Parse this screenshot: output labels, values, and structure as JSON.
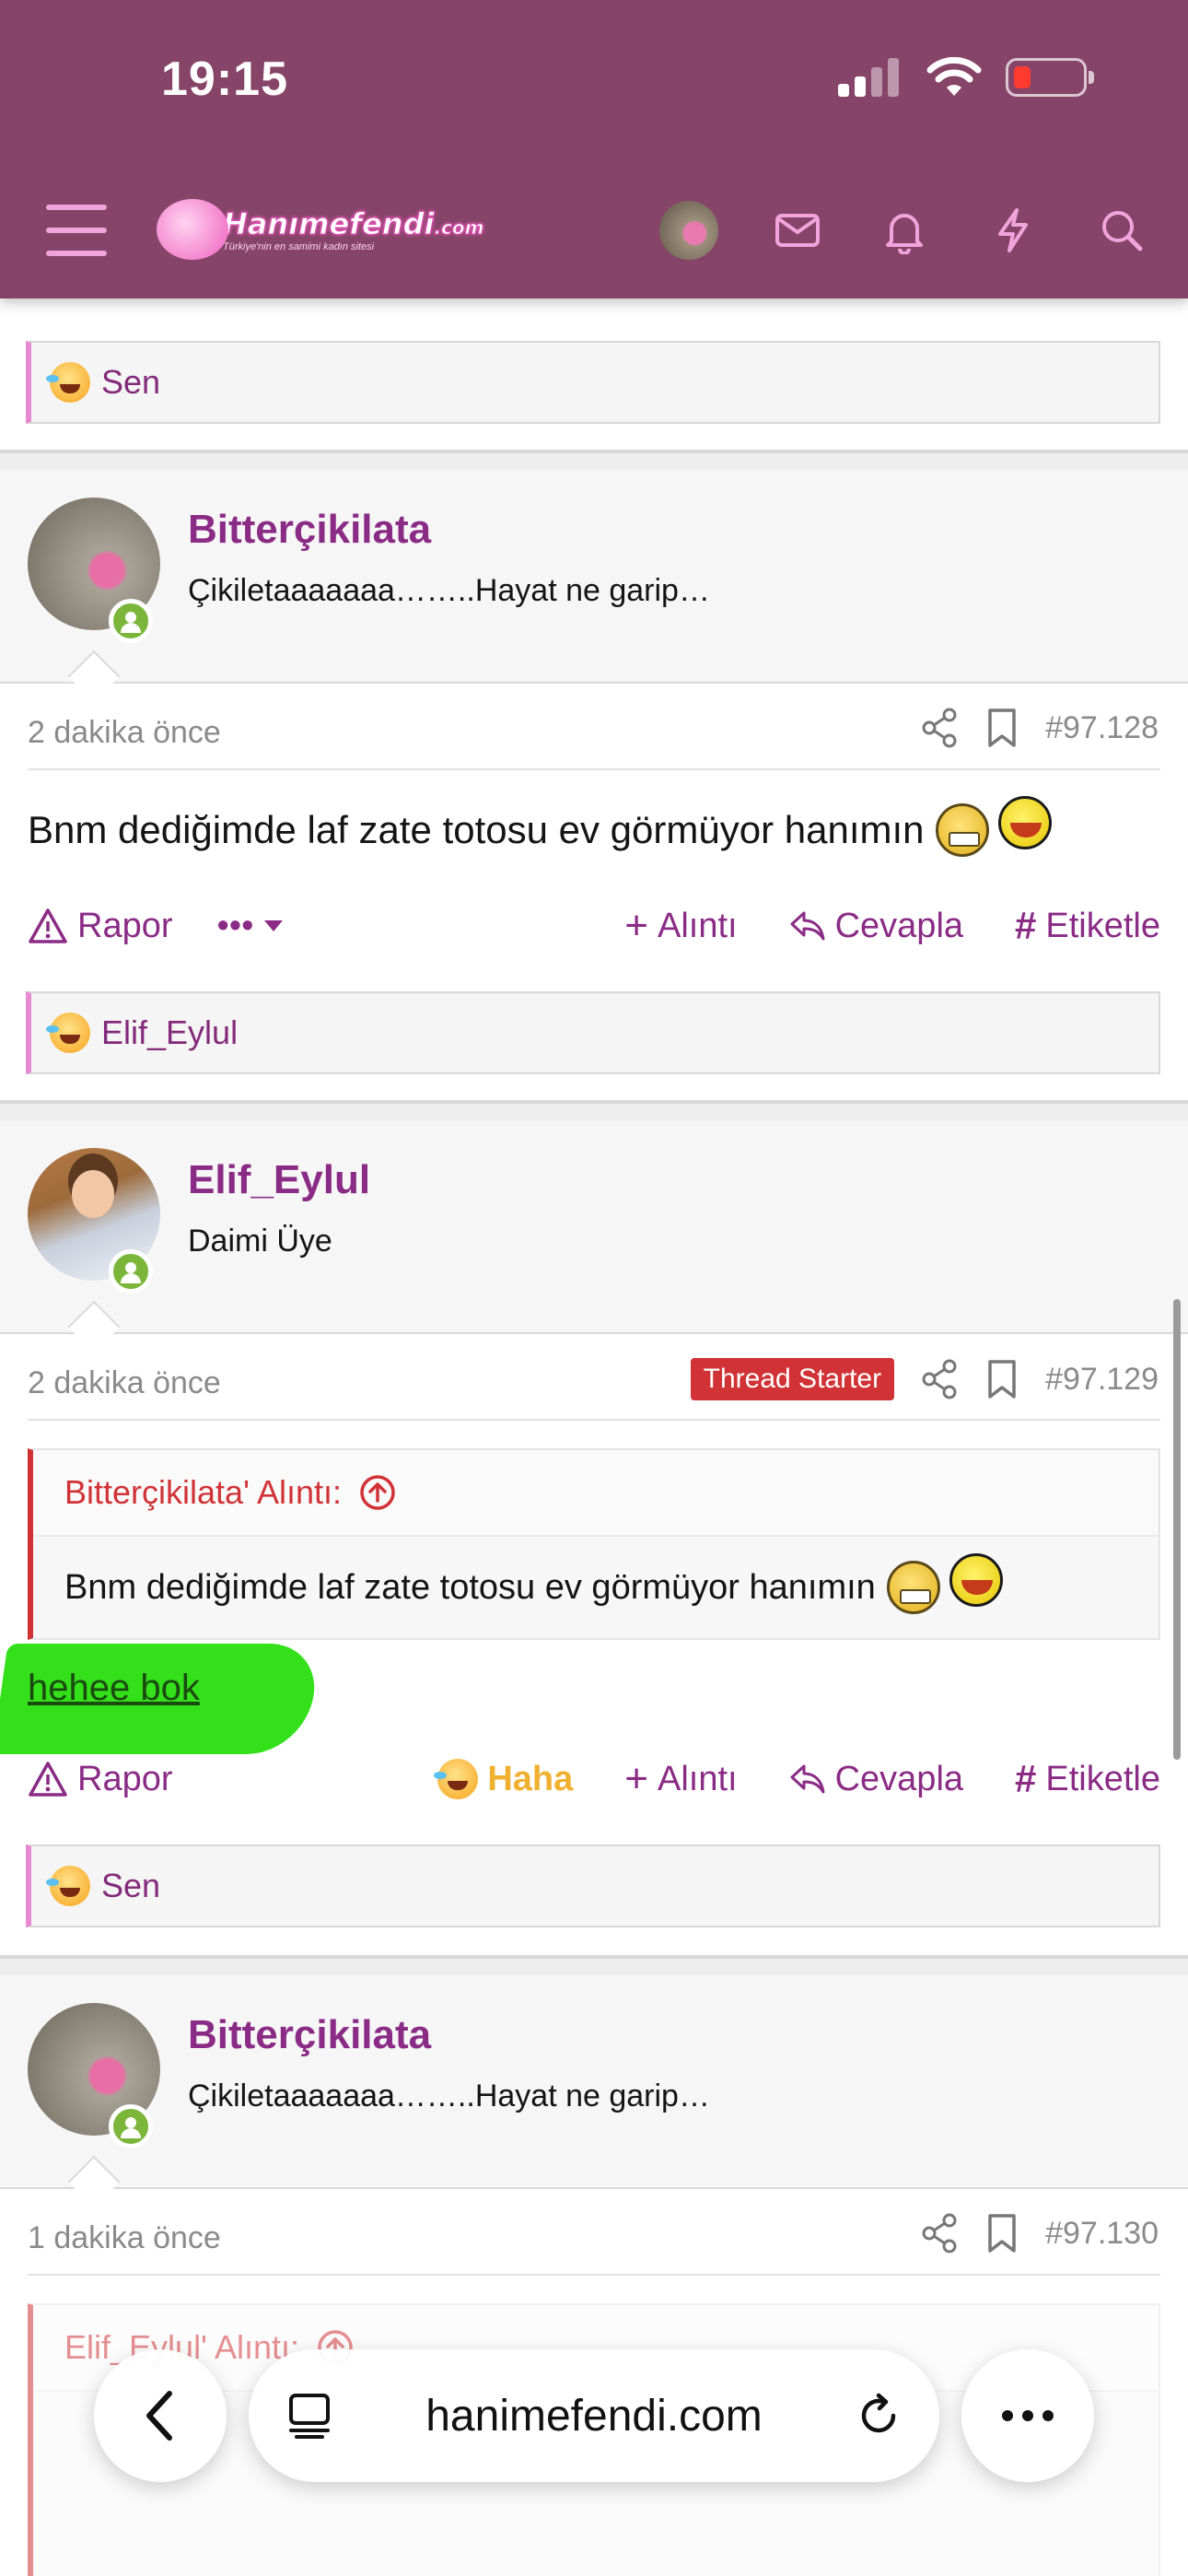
{
  "status_bar": {
    "time": "19:15"
  },
  "header": {
    "logo_name": "Hanımefendi",
    "logo_suffix": ".com",
    "logo_tagline": "Türkiye'nin en samimi kadın sitesi",
    "icons": [
      "menu-icon",
      "avatar",
      "mail-icon",
      "bell-icon",
      "bolt-icon",
      "search-icon"
    ]
  },
  "top_reaction": {
    "label": "Sen"
  },
  "posts": [
    {
      "username": "Bitterçikilata",
      "user_title": "Çikiletaaaaaaa……..Hayat ne garip…",
      "time": "2 dakika önce",
      "number": "#97.128",
      "message": "Bnm dediğimde laf zate totosu ev görmüyor hanımın",
      "actions": {
        "report": "Rapor",
        "more": "•••",
        "quote": "Alıntı",
        "reply": "Cevapla",
        "tag": "Etiketle"
      },
      "reaction": "Elif_Eylul"
    },
    {
      "username": "Elif_Eylul",
      "user_title": "Daimi Üye",
      "time": "2 dakika önce",
      "badge": "Thread Starter",
      "number": "#97.129",
      "quote_author": "Bitterçikilata' Alıntı:",
      "quote_text": "Bnm dediğimde laf zate totosu ev görmüyor hanımın",
      "message": "hehee bok",
      "actions": {
        "report": "Rapor",
        "haha": "Haha",
        "quote": "Alıntı",
        "reply": "Cevapla",
        "tag": "Etiketle"
      },
      "reaction": "Sen"
    },
    {
      "username": "Bitterçikilata",
      "user_title": "Çikiletaaaaaaa……..Hayat ne garip…",
      "time": "1 dakika önce",
      "number": "#97.130",
      "quote_author": "Elif_Eylul' Alıntı:"
    }
  ],
  "browser": {
    "url": "hanimefendi.com"
  },
  "colors": {
    "header_bg": "#864468",
    "accent": "#8a2b86",
    "quote_red": "#d13236",
    "online": "#7bb63a",
    "highlight": "#33e01a"
  }
}
